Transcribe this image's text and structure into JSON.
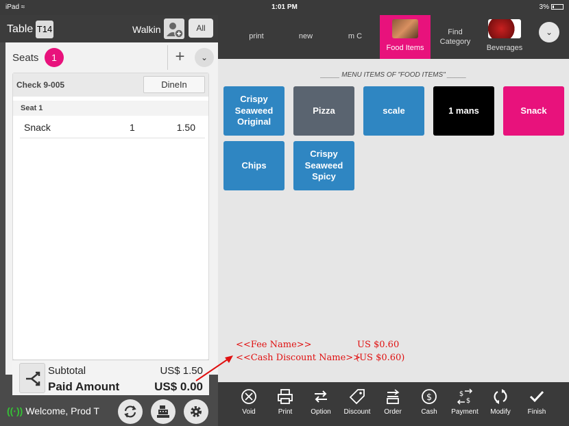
{
  "status_bar": {
    "device": "iPad",
    "time": "1:01 PM",
    "battery": "3%"
  },
  "header": {
    "table_label": "Table",
    "table_number": "T14",
    "customer": "Walkin",
    "all_label": "All"
  },
  "seats": {
    "label": "Seats",
    "count": "1"
  },
  "check": {
    "title": "Check  9-005",
    "mode_label": "DineIn",
    "seat_header": "Seat 1",
    "items": [
      {
        "name": "Snack",
        "qty": "1",
        "price": "1.50"
      }
    ]
  },
  "totals": {
    "subtotal_label": "Subtotal",
    "subtotal_value": "US$ 1.50",
    "paid_label": "Paid Amount",
    "paid_value": "US$ 0.00"
  },
  "footer": {
    "welcome": "Welcome, Prod T"
  },
  "nav": {
    "tabs": [
      {
        "label": "print"
      },
      {
        "label": "new"
      },
      {
        "label": "m C"
      },
      {
        "label": "Food Items"
      },
      {
        "label": "Find Category"
      },
      {
        "label": "Beverages"
      }
    ]
  },
  "menu": {
    "title": "_____ MENU ITEMS OF \"FOOD ITEMS\" _____",
    "items": [
      {
        "label": "Crispy Seaweed Original",
        "color": "#2f86c2"
      },
      {
        "label": "Pizza",
        "color": "#5a6470"
      },
      {
        "label": "scale",
        "color": "#2f86c2"
      },
      {
        "label": "1 mans",
        "color": "#000000"
      },
      {
        "label": "Snack",
        "color": "#e8127c"
      },
      {
        "label": "Chips",
        "color": "#2f86c2"
      },
      {
        "label": "Crispy Seaweed Spicy",
        "color": "#2f86c2"
      }
    ]
  },
  "annotation": {
    "fee_name": "<<Fee Name>>",
    "fee_value": "US $0.60",
    "discount_name": "<<Cash Discount Name>>",
    "discount_value": "(US $0.60)",
    "color": "#e01010"
  },
  "actions": [
    {
      "label": "Void",
      "icon": "void-icon"
    },
    {
      "label": "Print",
      "icon": "printer-icon"
    },
    {
      "label": "Option",
      "icon": "swap-icon"
    },
    {
      "label": "Discount",
      "icon": "tag-icon"
    },
    {
      "label": "Order",
      "icon": "order-icon"
    },
    {
      "label": "Cash",
      "icon": "dollar-icon"
    },
    {
      "label": "Payment",
      "icon": "payment-icon"
    },
    {
      "label": "Modify",
      "icon": "refresh-icon"
    },
    {
      "label": "Finish",
      "icon": "check-icon"
    }
  ],
  "colors": {
    "accent": "#e8127c",
    "dark_bar": "#3a3a3a",
    "tile_blue": "#2f86c2"
  }
}
